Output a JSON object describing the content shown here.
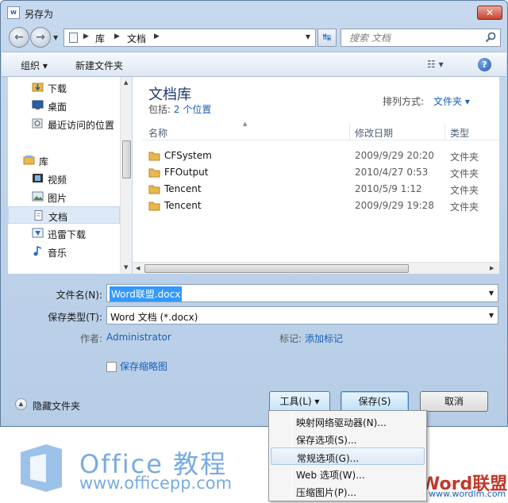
{
  "window": {
    "title": "另存为",
    "app_icon_text": "W"
  },
  "address": {
    "crumbs": [
      "库",
      "文档"
    ]
  },
  "search": {
    "placeholder": "搜索 文档"
  },
  "toolbar": {
    "organize": "组织 ▾",
    "new_folder": "新建文件夹",
    "views": "☷ ▾",
    "help": "?"
  },
  "nav": {
    "items": [
      {
        "label": "下载",
        "icon": "download-folder-icon"
      },
      {
        "label": "桌面",
        "icon": "desktop-icon"
      },
      {
        "label": "最近访问的位置",
        "icon": "recent-places-icon"
      },
      {
        "label": "库",
        "icon": "library-icon",
        "group": true
      },
      {
        "label": "视频",
        "icon": "video-library-icon"
      },
      {
        "label": "图片",
        "icon": "pictures-library-icon"
      },
      {
        "label": "文档",
        "icon": "documents-library-icon",
        "selected": true
      },
      {
        "label": "迅雷下载",
        "icon": "xunlei-folder-icon"
      },
      {
        "label": "音乐",
        "icon": "music-library-icon"
      }
    ]
  },
  "library": {
    "title": "文档库",
    "includes_label": "包括:",
    "includes_link": "2 个位置",
    "arrange_label": "排列方式:",
    "arrange_value": "文件夹 ▾"
  },
  "columns": {
    "name": "名称",
    "date": "修改日期",
    "type": "类型"
  },
  "files": [
    {
      "name": "CFSystem",
      "date": "2009/9/29 20:20",
      "type": "文件夹"
    },
    {
      "name": "FFOutput",
      "date": "2010/4/27 0:53",
      "type": "文件夹"
    },
    {
      "name": "Tencent",
      "date": "2010/5/9 1:12",
      "type": "文件夹"
    },
    {
      "name": "Tencent",
      "date": "2009/9/29 19:28",
      "type": "文件夹"
    }
  ],
  "form": {
    "filename_label": "文件名(N):",
    "filename_value": "Word联盟.docx",
    "filetype_label": "保存类型(T):",
    "filetype_value": "Word 文档 (*.docx)",
    "author_label": "作者:",
    "author_value": "Administrator",
    "tags_label": "标记:",
    "tags_value": "添加标记",
    "thumbnail_label": "保存缩略图",
    "thumbnail_checked": false,
    "hide_folders": "隐藏文件夹"
  },
  "buttons": {
    "tools": "工具(L)   ▾",
    "save": "保存(S)",
    "cancel": "取消"
  },
  "tools_menu": [
    {
      "label": "映射网络驱动器(N)..."
    },
    {
      "label": "保存选项(S)..."
    },
    {
      "label": "常规选项(G)...",
      "hover": true
    },
    {
      "label": "Web 选项(W)..."
    },
    {
      "label": "压缩图片(P)..."
    }
  ],
  "watermark": {
    "text": "Office 教程",
    "url": "www.officepp.com",
    "brand": "Word联盟",
    "brand_url": "www.wordlm.com"
  },
  "colors": {
    "accent": "#1a5fb4",
    "selection": "#3399ff",
    "folder": "#e8b84a"
  }
}
